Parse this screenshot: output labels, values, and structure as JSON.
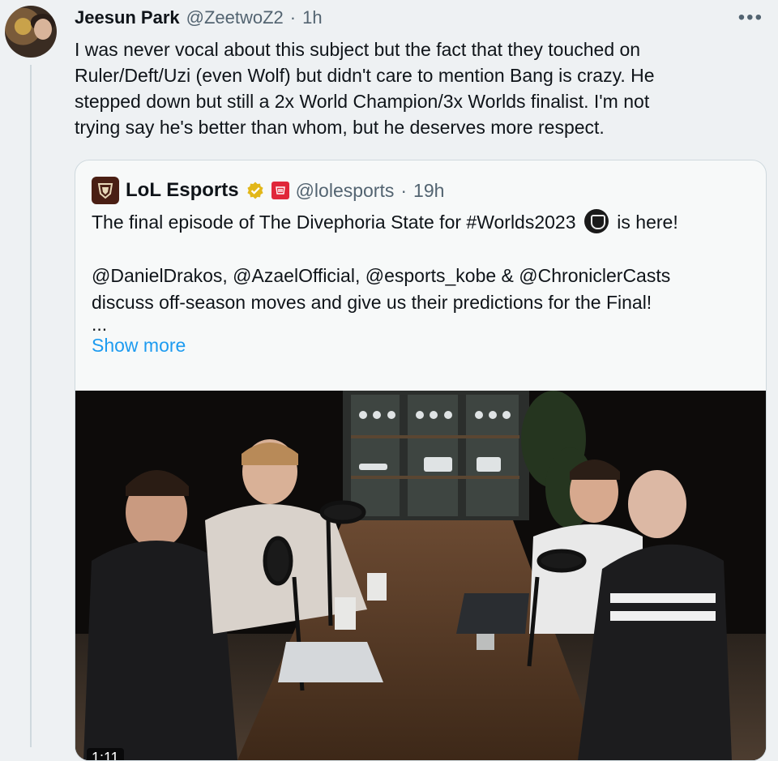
{
  "tweet": {
    "author_name": "Jeesun Park",
    "handle": "@ZeetwoZ2",
    "separator": "·",
    "time": "1h",
    "more_icon": "more-horizontal-icon",
    "text_lines": [
      "I was never vocal about this subject but the fact that they touched on",
      "Ruler/Deft/Uzi (even Wolf) but didn't care to mention Bang is crazy. He",
      "stepped down but still a 2x World Champion/3x Worlds finalist. I'm not",
      "trying say he's better than whom, but he deserves more respect."
    ]
  },
  "quote": {
    "author_name": "LoL Esports",
    "handle": "@lolesports",
    "separator": "·",
    "time": "19h",
    "line1_before": "The final episode of The Divephoria State for #Worlds2023",
    "line1_after": "is here!",
    "line2": "@DanielDrakos, @AzaelOfficial, @esports_kobe & @ChroniclerCasts",
    "line3": "discuss off-season moves and give us their predictions for the Final!",
    "ellipsis": "...",
    "show_more": "Show more",
    "video_time": "1:11"
  },
  "colors": {
    "link": "#1d9bf0",
    "muted": "#536471",
    "verified": "#e2b719",
    "affiliate_badge": "#e0273a"
  }
}
